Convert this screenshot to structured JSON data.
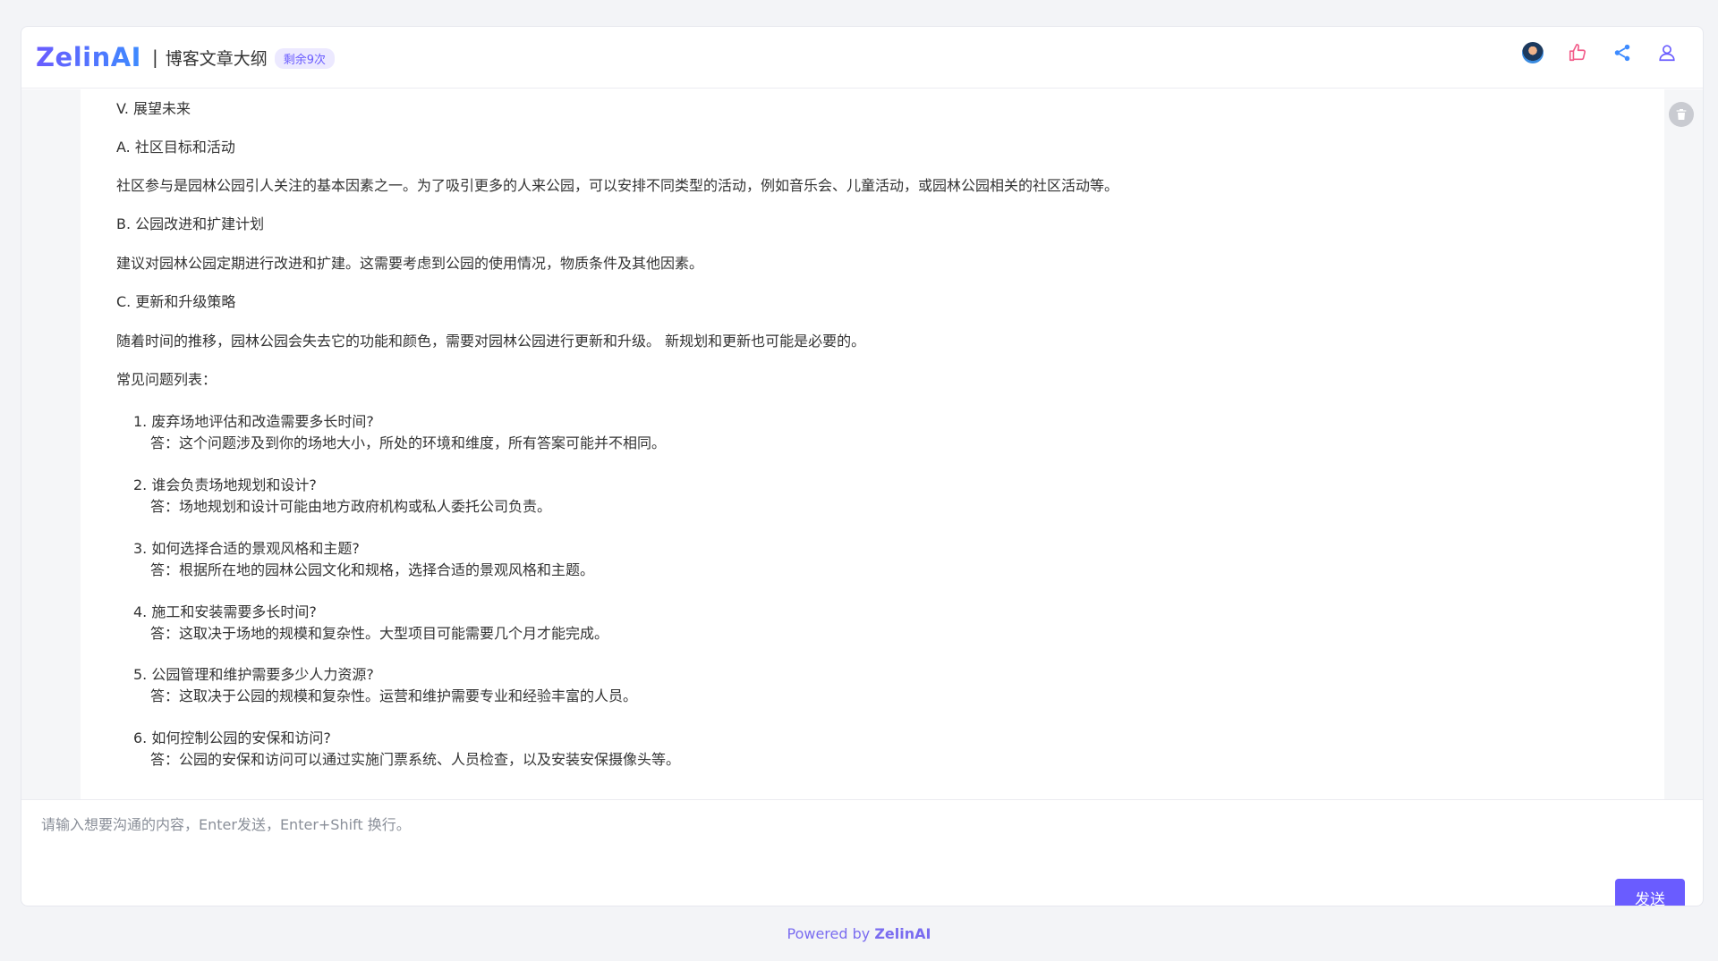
{
  "header": {
    "logo": "ZelinAI",
    "separator": "|",
    "title": "博客文章大纲",
    "badge": "剩余9次",
    "icons": [
      "avatar",
      "thumbs-up-icon",
      "share-icon",
      "user-icon"
    ]
  },
  "content": {
    "paragraphs": [
      "V. 展望未来",
      "A. 社区目标和活动",
      "社区参与是园林公园引人关注的基本因素之一。为了吸引更多的人来公园，可以安排不同类型的活动，例如音乐会、儿童活动，或园林公园相关的社区活动等。",
      "B. 公园改进和扩建计划",
      "建议对园林公园定期进行改进和扩建。这需要考虑到公园的使用情况，物质条件及其他因素。",
      "C. 更新和升级策略",
      "随着时间的推移，园林公园会失去它的功能和颜色，需要对园林公园进行更新和升级。 新规划和更新也可能是必要的。",
      "常见问题列表："
    ],
    "faq": [
      {
        "q": "1. 废弃场地评估和改造需要多长时间?",
        "a": "答：这个问题涉及到你的场地大小，所处的环境和维度，所有答案可能并不相同。"
      },
      {
        "q": "2. 谁会负责场地规划和设计?",
        "a": "答：场地规划和设计可能由地方政府机构或私人委托公司负责。"
      },
      {
        "q": "3. 如何选择合适的景观风格和主题?",
        "a": "答：根据所在地的园林公园文化和规格，选择合适的景观风格和主题。"
      },
      {
        "q": "4. 施工和安装需要多长时间?",
        "a": "答：这取决于场地的规模和复杂性。大型项目可能需要几个月才能完成。"
      },
      {
        "q": "5. 公园管理和维护需要多少人力资源?",
        "a": "答：这取决于公园的规模和复杂性。运营和维护需要专业和经验丰富的人员。"
      },
      {
        "q": "6. 如何控制公园的安保和访问?",
        "a": "答：公园的安保和访问可以通过实施门票系统、人员检查，以及安装安保摄像头等。"
      }
    ]
  },
  "input": {
    "placeholder": "请输入想要沟通的内容，Enter发送，Enter+Shift 换行。",
    "value": ""
  },
  "send_label": "发送",
  "footer": {
    "powered": "Powered by",
    "brand": "ZelinAI"
  },
  "colors": {
    "accent": "#6a5cff",
    "background": "#f3f4f7"
  }
}
